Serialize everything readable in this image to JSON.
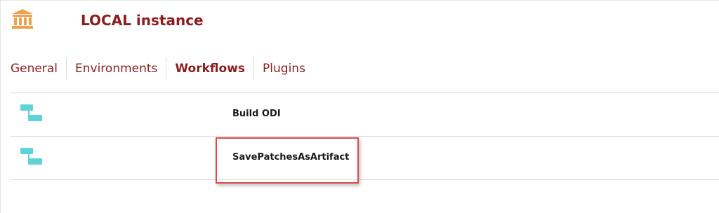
{
  "header": {
    "title": "LOCAL instance",
    "icon": "bank-building-icon",
    "icon_color": "#f0a04b"
  },
  "tabs": [
    {
      "label": "General",
      "active": false
    },
    {
      "label": "Environments",
      "active": false
    },
    {
      "label": "Workflows",
      "active": true
    },
    {
      "label": "Plugins",
      "active": false
    }
  ],
  "workflows": [
    {
      "name": "Build ODI",
      "icon": "workflow-icon"
    },
    {
      "name": "SavePatchesAsArtifact",
      "icon": "workflow-icon",
      "highlighted": true
    }
  ],
  "colors": {
    "accent": "#8b1e1e",
    "workflow_icon": "#5fd3d8",
    "highlight_border": "#e04848"
  }
}
